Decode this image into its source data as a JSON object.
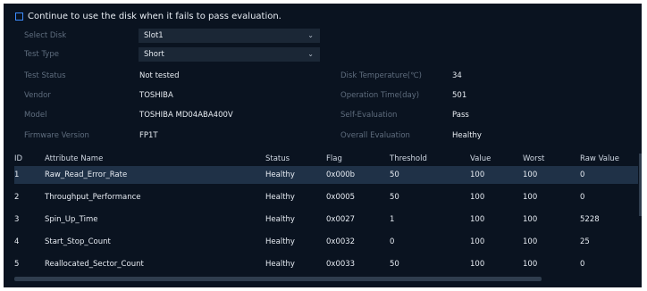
{
  "evaluation_checkbox": {
    "checked": false,
    "label": "Continue to use the disk when it fails to pass evaluation."
  },
  "select_disk": {
    "label": "Select Disk",
    "value": "Slot1"
  },
  "test_type": {
    "label": "Test Type",
    "value": "Short"
  },
  "info_left": [
    {
      "label": "Test Status",
      "value": "Not tested"
    },
    {
      "label": "Vendor",
      "value": "TOSHIBA"
    },
    {
      "label": "Model",
      "value": "TOSHIBA MD04ABA400V"
    },
    {
      "label": "Firmware Version",
      "value": "FP1T"
    }
  ],
  "info_right": [
    {
      "label": "Disk Temperature(℃)",
      "value": "34"
    },
    {
      "label": "Operation Time(day)",
      "value": "501"
    },
    {
      "label": "Self-Evaluation",
      "value": "Pass"
    },
    {
      "label": "Overall Evaluation",
      "value": "Healthy"
    }
  ],
  "table": {
    "headers": [
      "ID",
      "Attribute Name",
      "Status",
      "Flag",
      "Threshold",
      "Value",
      "Worst",
      "Raw Value"
    ],
    "rows": [
      [
        "1",
        "Raw_Read_Error_Rate",
        "Healthy",
        "0x000b",
        "50",
        "100",
        "100",
        "0"
      ],
      [
        "2",
        "Throughput_Performance",
        "Healthy",
        "0x0005",
        "50",
        "100",
        "100",
        "0"
      ],
      [
        "3",
        "Spin_Up_Time",
        "Healthy",
        "0x0027",
        "1",
        "100",
        "100",
        "5228"
      ],
      [
        "4",
        "Start_Stop_Count",
        "Healthy",
        "0x0032",
        "0",
        "100",
        "100",
        "25"
      ],
      [
        "5",
        "Reallocated_Sector_Count",
        "Healthy",
        "0x0033",
        "50",
        "100",
        "100",
        "0"
      ]
    ]
  },
  "icons": {
    "dropdown": "chevron-down-icon"
  },
  "colors": {
    "background": "#0a1320",
    "selected_row": "#1f3147",
    "checkbox_border": "#3d8cff",
    "field_bg": "#1b2736"
  }
}
